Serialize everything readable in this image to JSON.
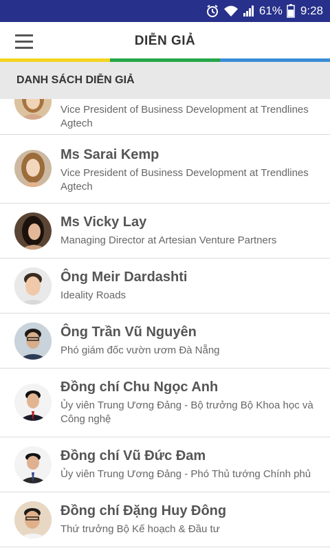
{
  "status_bar": {
    "battery": "61%",
    "time": "9:28"
  },
  "app_bar": {
    "title": "DIỄN GIẢ"
  },
  "section": {
    "title": "DANH SÁCH DIỄN GIẢ"
  },
  "speakers": [
    {
      "name": "",
      "role": "Vice President of Business Development at Trendlines Agtech"
    },
    {
      "name": "Ms Sarai Kemp",
      "role": "Vice President of Business Development at Trendlines Agtech"
    },
    {
      "name": "Ms Vicky Lay",
      "role": "Managing Director at Artesian Venture Partners"
    },
    {
      "name": "Ông Meir Dardashti",
      "role": "Ideality Roads"
    },
    {
      "name": "Ông Trần Vũ Nguyên",
      "role": "Phó giám đốc vườn ươm Đà Nẵng"
    },
    {
      "name": "Đồng chí Chu Ngọc Anh",
      "role": "Ủy viên Trung Ương Đảng - Bộ trưởng Bộ Khoa học và Công nghệ"
    },
    {
      "name": "Đồng chí Vũ Đức Đam",
      "role": "Ủy viên Trung Ương Đảng - Phó Thủ tướng Chính phủ"
    },
    {
      "name": "Đồng chí Đặng Huy Đông",
      "role": "Thứ trưởng Bộ Kế hoạch & Đầu tư"
    }
  ]
}
